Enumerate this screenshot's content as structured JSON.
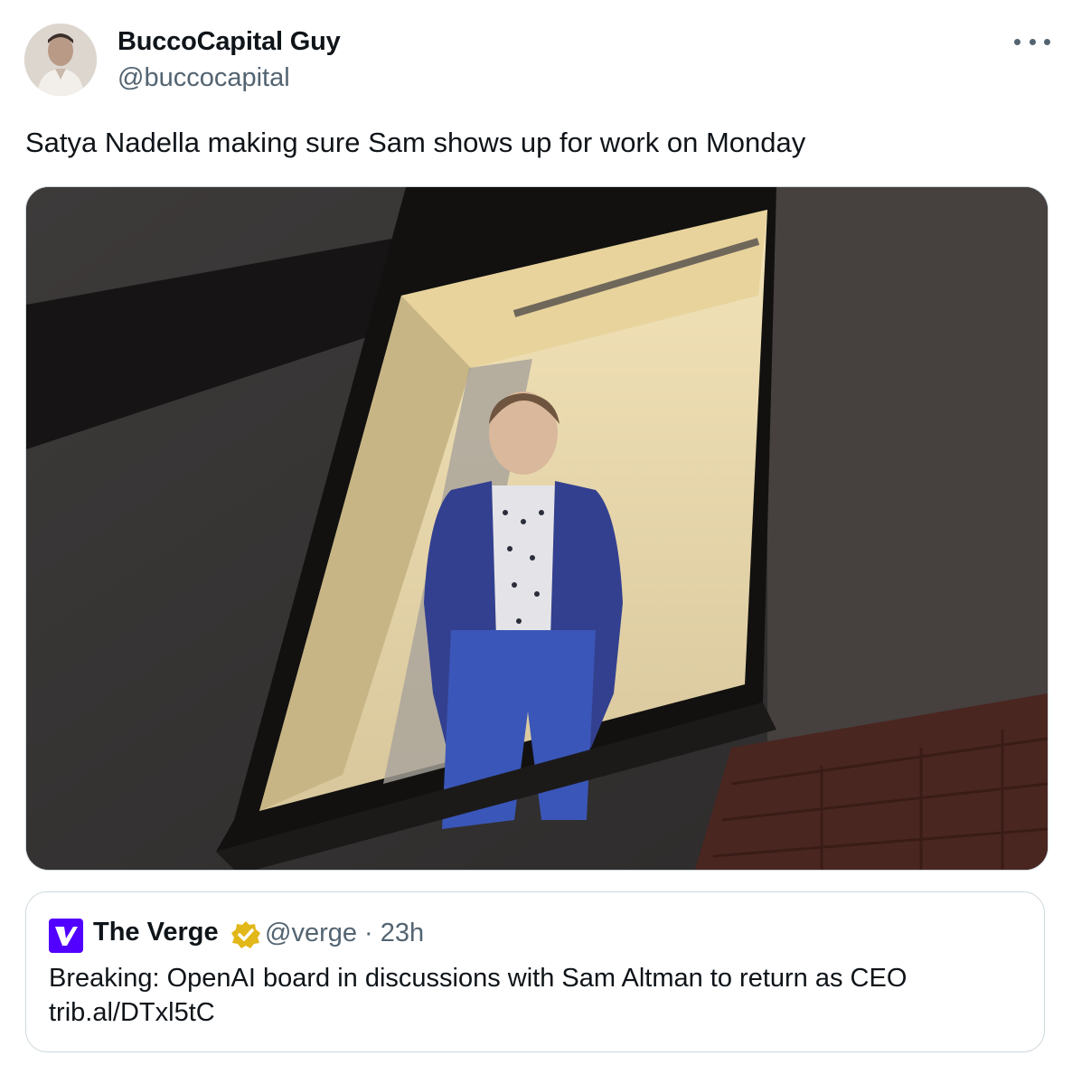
{
  "tweet": {
    "author": {
      "name": "BuccoCapital Guy",
      "handle": "@buccocapital"
    },
    "text": "Satya Nadella making sure Sam shows up for work on Monday",
    "more_icon": "more-horizontal-icon",
    "media": {
      "description_icon": "photo"
    }
  },
  "quote": {
    "author": {
      "name": "The Verge",
      "handle": "@verge",
      "separator": "·",
      "time": "23h",
      "verified": true,
      "badge_color": "#e2b719",
      "brand_color": "#5200ff"
    },
    "text_line1": "Breaking: OpenAI board in discussions with Sam Altman to return as CEO",
    "text_line2": "trib.al/DTxl5tC"
  }
}
